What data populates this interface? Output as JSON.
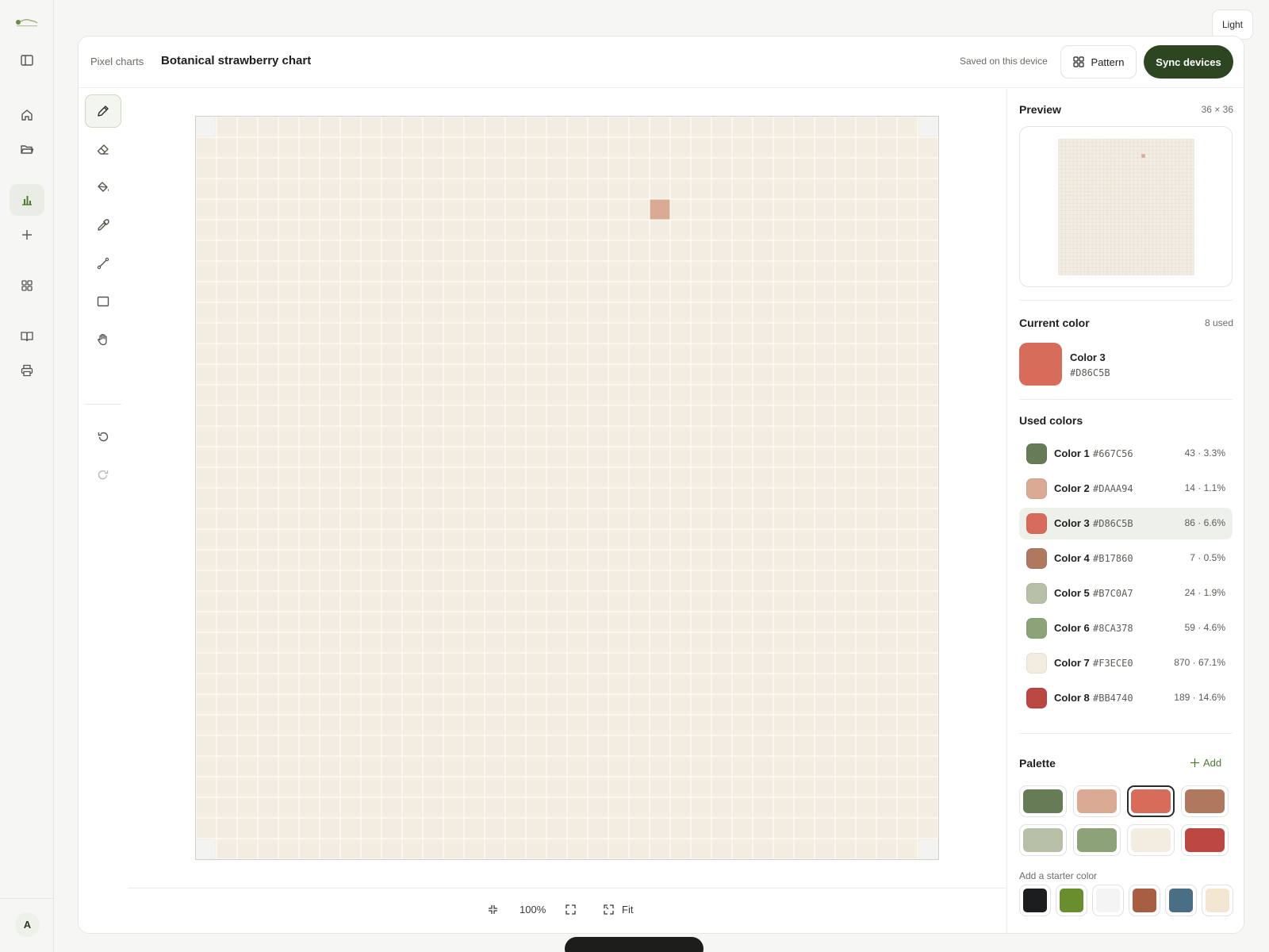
{
  "app": {
    "theme_toggle": "Light",
    "avatar_initial": "A"
  },
  "rail": [
    {
      "name": "sidebar-toggle",
      "icon": "sidebar-icon"
    },
    {
      "name": "home",
      "icon": "home-icon"
    },
    {
      "name": "projects",
      "icon": "folder-open-icon"
    },
    {
      "name": "charts",
      "icon": "bar-chart-icon",
      "active": true
    },
    {
      "name": "new",
      "icon": "plus-icon"
    },
    {
      "name": "apps",
      "icon": "grid-icon"
    },
    {
      "name": "library",
      "icon": "book-icon"
    },
    {
      "name": "print",
      "icon": "printer-icon"
    }
  ],
  "header": {
    "breadcrumb": "Pixel charts",
    "title": "Botanical strawberry chart",
    "save_status": "Saved on this device",
    "pattern_button": "Pattern",
    "sync_button": "Sync devices"
  },
  "tools": [
    {
      "name": "pencil",
      "icon": "pencil-icon",
      "active": true
    },
    {
      "name": "eraser",
      "icon": "eraser-icon"
    },
    {
      "name": "fill",
      "icon": "paint-bucket-icon"
    },
    {
      "name": "eyedropper",
      "icon": "eyedropper-icon"
    },
    {
      "name": "line",
      "icon": "line-icon"
    },
    {
      "name": "rectangle",
      "icon": "rectangle-icon"
    },
    {
      "name": "pan",
      "icon": "hand-icon"
    },
    {
      "name": "undo",
      "icon": "undo-icon"
    },
    {
      "name": "redo",
      "icon": "redo-icon"
    }
  ],
  "zoom": {
    "level": "100%",
    "fit_label": "Fit"
  },
  "preview": {
    "title": "Preview",
    "size": "36 × 36"
  },
  "current_color": {
    "title": "Current color",
    "used_count": "8 used",
    "name": "Color 3",
    "hex": "#D86C5B"
  },
  "used_colors": {
    "title": "Used colors",
    "items": [
      {
        "name": "Color 1",
        "hex": "#667C56",
        "stat": "43 · 3.3%"
      },
      {
        "name": "Color 2",
        "hex": "#DAAA94",
        "stat": "14 · 1.1%"
      },
      {
        "name": "Color 3",
        "hex": "#D86C5B",
        "stat": "86 · 6.6%",
        "selected": true
      },
      {
        "name": "Color 4",
        "hex": "#B17860",
        "stat": "7 · 0.5%"
      },
      {
        "name": "Color 5",
        "hex": "#B7C0A7",
        "stat": "24 · 1.9%"
      },
      {
        "name": "Color 6",
        "hex": "#8CA378",
        "stat": "59 · 4.6%"
      },
      {
        "name": "Color 7",
        "hex": "#F3ECE0",
        "stat": "870 · 67.1%"
      },
      {
        "name": "Color 8",
        "hex": "#BB4740",
        "stat": "189 · 14.6%"
      }
    ]
  },
  "palette": {
    "title": "Palette",
    "add_label": "Add",
    "swatches": [
      "#667C56",
      "#DAAA94",
      "#D86C5B",
      "#B17860",
      "#B7C0A7",
      "#8CA378",
      "#F3ECE0",
      "#BB4740"
    ],
    "selected_index": 2,
    "starter_label": "Add a starter color",
    "starter_swatches": [
      "#1C1D1E",
      "#6A8E2E",
      "#F4F4F4",
      "#A85E43",
      "#4A6E84",
      "#F3E6D0"
    ]
  },
  "pattern": {
    "size": 36,
    "background": 7,
    "colors": {
      "1": "#667C56",
      "2": "#DAAA94",
      "3": "#D86C5B",
      "4": "#B17860",
      "5": "#B7C0A7",
      "6": "#8CA378",
      "7": "#F3ECE0",
      "8": "#BB4740"
    },
    "rows": [
      "777777777777777777777777777777777777",
      "777777777777777777777777777777777777",
      "777777777777777777777777777777777777",
      "777777777777777777777777777777777777",
      "777777777777777777777727777777777777",
      "777777777777777777777777777777777777",
      "777777777777777777777777777777777777",
      "777777777777777777777777777777777777",
      "777777777777777777777777777777777777",
      "777777777777777777777777777777777777",
      "777777777777777777777777777777777777",
      "777777777777777777777777777777777777",
      "777777777777777777777777777777777777",
      "777777777777777777777777777777777777",
      "777777777777777777777777777777777777",
      "777777777777777777777777777777777777",
      "777777777777777777777777777777777777",
      "777777777777777777777777777777777777",
      "777777777777777777777777777777777777",
      "777777777777777777777777777777777777",
      "777777777777777777777777777777777777",
      "777777777777777777777777777777777777",
      "777777777777777777777777777777777777",
      "777777777777777777777777777777777777",
      "777777777777777777777777777777777777",
      "777777777777777777777777777777777777",
      "777777777777777777777777777777777777",
      "777777777777777777777777777777777777",
      "777777777777777777777777777777777777",
      "777777777777777777777777777777777777",
      "777777777777777777777777777777777777",
      "777777777777777777777777777777777777",
      "777777777777777777777777777777777777",
      "777777777777777777777777777777777777",
      "777777777777777777777777777777777777",
      "777777777777777777777777777777777777"
    ]
  }
}
